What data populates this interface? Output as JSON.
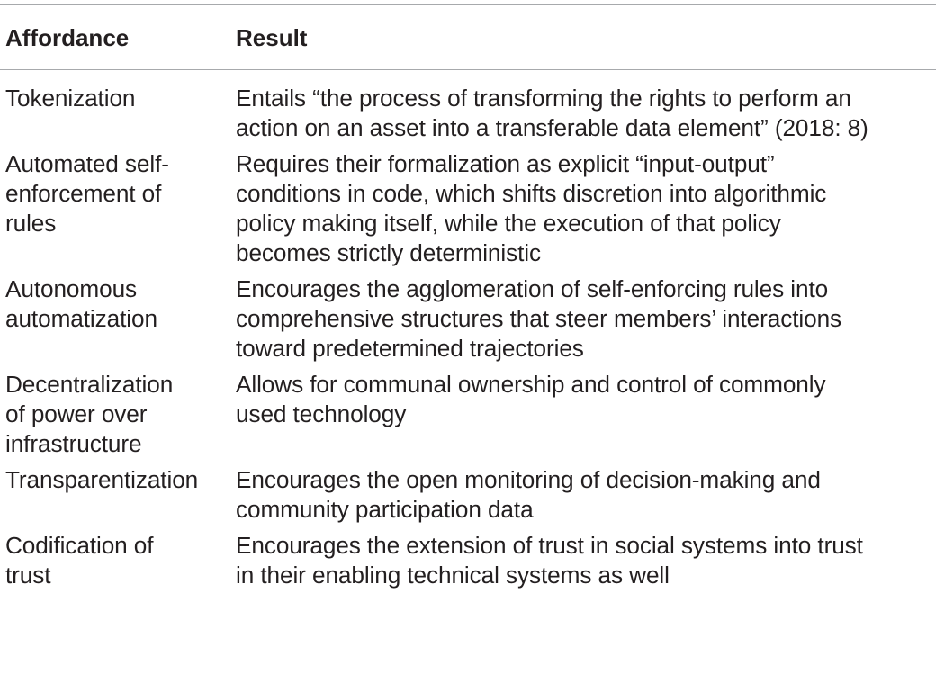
{
  "table": {
    "headers": {
      "affordance": "Affordance",
      "result": "Result"
    },
    "rows": [
      {
        "affordance_lines": [
          "Tokenization"
        ],
        "result_lines": [
          "Entails “the process of transforming the rights to perform an",
          "action on an asset into a transferable data element” (2018: 8)"
        ]
      },
      {
        "affordance_lines": [
          "Automated self-",
          "enforcement of",
          "rules"
        ],
        "result_lines": [
          "Requires their formalization as explicit “input-output”",
          "conditions in code, which shifts discretion into algorithmic",
          "policy making itself, while the execution of that policy",
          "becomes strictly deterministic"
        ]
      },
      {
        "affordance_lines": [
          "Autonomous",
          "automatization"
        ],
        "result_lines": [
          "Encourages the agglomeration of self-enforcing rules into",
          "comprehensive structures that steer members’ interactions",
          "toward predetermined trajectories"
        ]
      },
      {
        "affordance_lines": [
          "Decentralization",
          "of power over",
          "infrastructure"
        ],
        "result_lines": [
          "Allows for communal ownership and control of commonly",
          "used technology"
        ]
      },
      {
        "affordance_lines": [
          "Transparentization"
        ],
        "result_lines": [
          "Encourages the open monitoring of decision-making and",
          "community participation data"
        ]
      },
      {
        "affordance_lines": [
          "Codification of",
          "trust"
        ],
        "result_lines": [
          "Encourages the extension of trust in social systems into trust",
          "in their enabling technical systems as well"
        ]
      }
    ]
  }
}
